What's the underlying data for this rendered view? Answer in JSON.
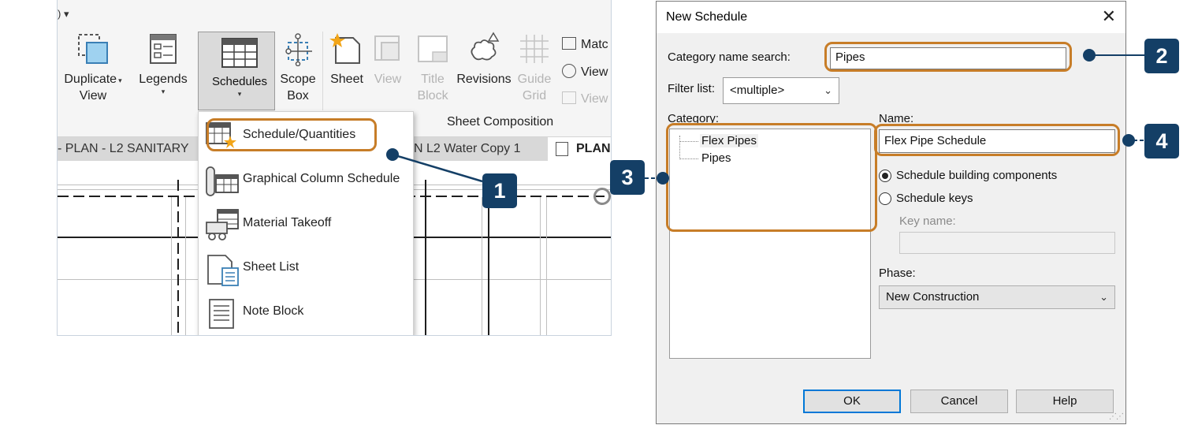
{
  "ribbon": {
    "qat_text": ") ▾",
    "buttons": [
      {
        "label_1": "Duplicate",
        "label_2": "View",
        "caret": "▾",
        "icon": "duplicate-view-icon"
      },
      {
        "label_1": "Legends",
        "label_2": "",
        "caret": "▾",
        "icon": "legends-icon"
      },
      {
        "label_1": "Schedules",
        "label_2": "",
        "caret": "▾",
        "icon": "schedules-icon"
      },
      {
        "label_1": "Scope",
        "label_2": "Box",
        "caret": "",
        "icon": "scope-box-icon"
      },
      {
        "label_1": "Sheet",
        "label_2": "",
        "caret": "",
        "icon": "sheet-icon"
      },
      {
        "label_1": "View",
        "label_2": "",
        "caret": "",
        "icon": "view-icon"
      },
      {
        "label_1": "Title",
        "label_2": "Block",
        "caret": "",
        "icon": "title-block-icon"
      },
      {
        "label_1": "Revisions",
        "label_2": "",
        "caret": "",
        "icon": "revisions-icon"
      },
      {
        "label_1": "Guide",
        "label_2": "Grid",
        "caret": "",
        "icon": "guide-grid-icon"
      }
    ],
    "small_buttons": [
      "Matc",
      "View",
      "View"
    ],
    "panel_label": "Sheet Composition"
  },
  "tabs": [
    {
      "label": "- PLAN - L2 SANITARY"
    },
    {
      "label": "N L2 Water Copy 1"
    },
    {
      "label": "PLAN"
    }
  ],
  "schedules_menu": {
    "items": [
      {
        "label": "Schedule/Quantities",
        "icon": "schedule-quantities-icon"
      },
      {
        "label": "Graphical Column Schedule",
        "icon": "graphical-column-schedule-icon"
      },
      {
        "label": "Material Takeoff",
        "icon": "material-takeoff-icon"
      },
      {
        "label": "Sheet List",
        "icon": "sheet-list-icon"
      },
      {
        "label": "Note Block",
        "icon": "note-block-icon"
      }
    ]
  },
  "callouts": [
    "1",
    "2",
    "3",
    "4"
  ],
  "dialog": {
    "title": "New Schedule",
    "close_glyph": "✕",
    "category_search_label": "Category name search:",
    "category_search_value": "Pipes",
    "filter_label": "Filter list:",
    "filter_value": "<multiple>",
    "category_label": "Category:",
    "categories": [
      "Flex Pipes",
      "Pipes"
    ],
    "name_label": "Name:",
    "name_value": "Flex Pipe Schedule",
    "radio_components": "Schedule building components",
    "radio_keys": "Schedule keys",
    "key_name_label": "Key name:",
    "key_name_value": "",
    "phase_label": "Phase:",
    "phase_value": "New Construction",
    "ok_label": "OK",
    "cancel_label": "Cancel",
    "help_label": "Help"
  },
  "colors": {
    "highlight": "#c77d28",
    "callout": "#143f66",
    "dialog_bg": "#f0f0f0"
  }
}
